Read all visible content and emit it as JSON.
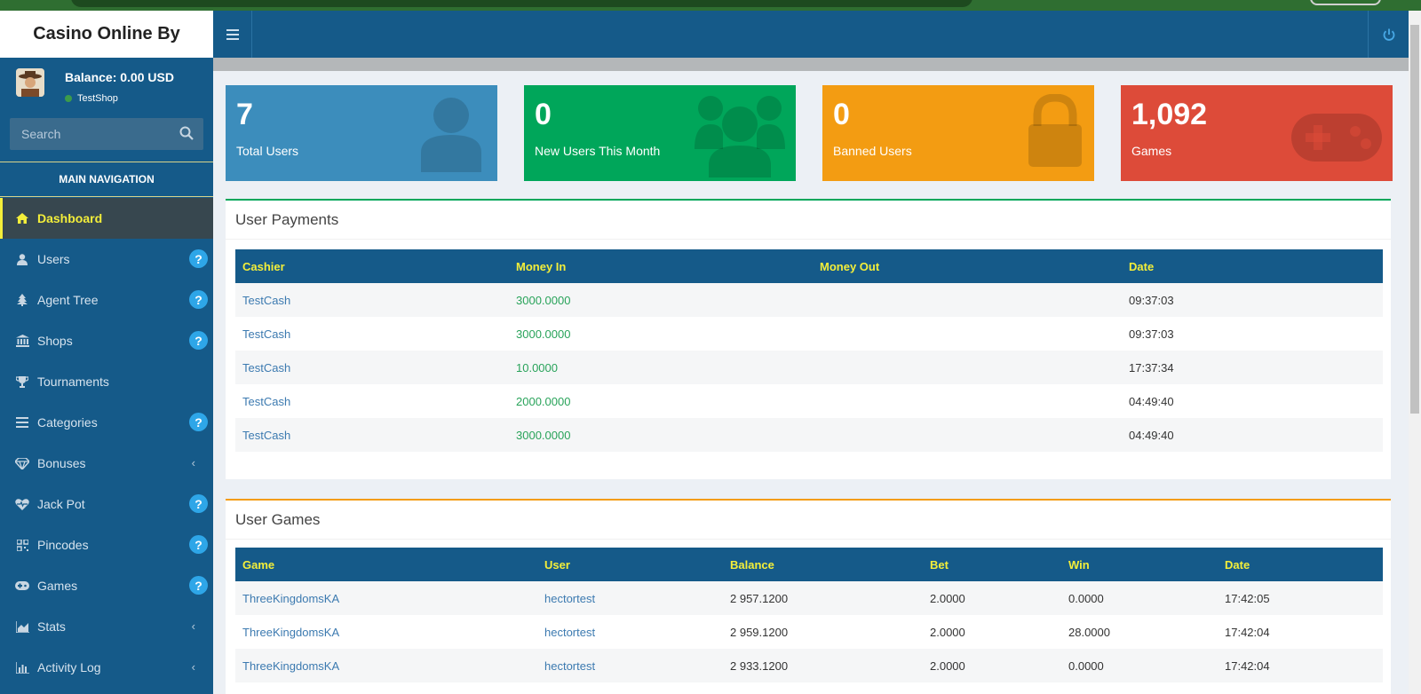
{
  "app": {
    "title": "Casino Online By"
  },
  "user": {
    "balance": "Balance: 0.00 USD",
    "shop": "TestShop"
  },
  "search": {
    "placeholder": "Search"
  },
  "nav": {
    "header": "MAIN NAVIGATION",
    "items": [
      {
        "label": "Dashboard",
        "icon": "home-icon"
      },
      {
        "label": "Users",
        "icon": "user-icon",
        "help": "?"
      },
      {
        "label": "Agent Tree",
        "icon": "tree-icon",
        "help": "?"
      },
      {
        "label": "Shops",
        "icon": "bank-icon",
        "help": "?"
      },
      {
        "label": "Tournaments",
        "icon": "trophy-icon"
      },
      {
        "label": "Categories",
        "icon": "list-icon",
        "help": "?"
      },
      {
        "label": "Bonuses",
        "icon": "diamond-icon",
        "chevron": "‹"
      },
      {
        "label": "Jack Pot",
        "icon": "heartbeat-icon",
        "help": "?"
      },
      {
        "label": "Pincodes",
        "icon": "qrcode-icon",
        "help": "?"
      },
      {
        "label": "Games",
        "icon": "gamepad-icon",
        "help": "?"
      },
      {
        "label": "Stats",
        "icon": "area-chart-icon",
        "chevron": "‹"
      },
      {
        "label": "Activity Log",
        "icon": "bar-chart-icon",
        "chevron": "‹"
      }
    ]
  },
  "stats": [
    {
      "value": "7",
      "label": "Total Users",
      "color": "#3c8dbc"
    },
    {
      "value": "0",
      "label": "New Users This Month",
      "color": "#00a65a"
    },
    {
      "value": "0",
      "label": "Banned Users",
      "color": "#f39c12"
    },
    {
      "value": "1,092",
      "label": "Games",
      "color": "#dd4b39"
    }
  ],
  "payments": {
    "title": "User Payments",
    "headers": [
      "Cashier",
      "Money In",
      "Money Out",
      "Date"
    ],
    "rows": [
      [
        "TestCash",
        "3000.0000",
        "",
        "09:37:03"
      ],
      [
        "TestCash",
        "3000.0000",
        "",
        "09:37:03"
      ],
      [
        "TestCash",
        "10.0000",
        "",
        "17:37:34"
      ],
      [
        "TestCash",
        "2000.0000",
        "",
        "04:49:40"
      ],
      [
        "TestCash",
        "3000.0000",
        "",
        "04:49:40"
      ]
    ]
  },
  "games": {
    "title": "User Games",
    "headers": [
      "Game",
      "User",
      "Balance",
      "Bet",
      "Win",
      "Date"
    ],
    "rows": [
      [
        "ThreeKingdomsKA",
        "hectortest",
        "2 957.1200",
        "2.0000",
        "0.0000",
        "17:42:05"
      ],
      [
        "ThreeKingdomsKA",
        "hectortest",
        "2 959.1200",
        "2.0000",
        "28.0000",
        "17:42:04"
      ],
      [
        "ThreeKingdomsKA",
        "hectortest",
        "2 933.1200",
        "2.0000",
        "0.0000",
        "17:42:04"
      ]
    ]
  }
}
